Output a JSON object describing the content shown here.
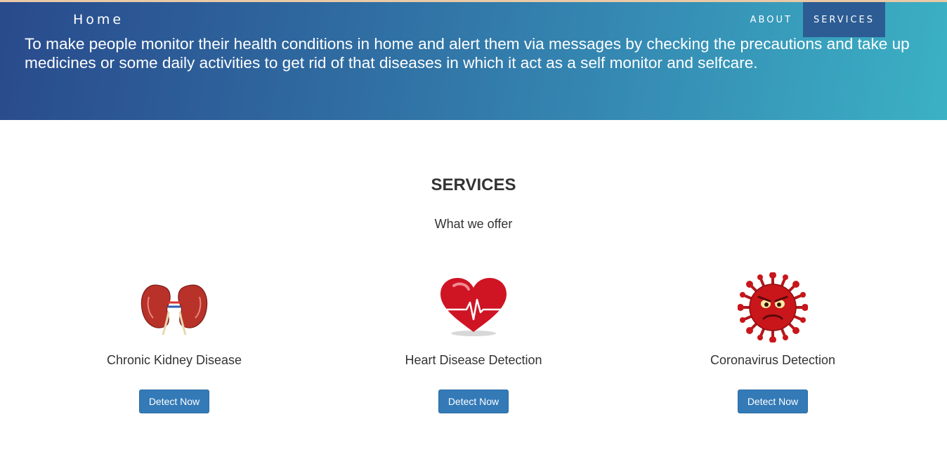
{
  "nav": {
    "brand": "Home",
    "items": [
      {
        "label": "ABOUT",
        "active": false
      },
      {
        "label": "SERVICES",
        "active": true
      }
    ]
  },
  "hero": {
    "mission": "To make people monitor their health conditions in home and alert them via messages by checking the precautions and take up medicines or some daily activities to get rid of that diseases in which it act as a self monitor and selfcare."
  },
  "services": {
    "title": "SERVICES",
    "subtitle": "What we offer",
    "cards": [
      {
        "label": "Chronic Kidney Disease",
        "icon": "kidney-icon",
        "button": "Detect Now"
      },
      {
        "label": "Heart Disease Detection",
        "icon": "heart-icon",
        "button": "Detect Now"
      },
      {
        "label": "Coronavirus Detection",
        "icon": "coronavirus-icon",
        "button": "Detect Now"
      }
    ]
  },
  "colors": {
    "hero_start": "#294a8c",
    "hero_end": "#3bb1c4",
    "button": "#337ab7",
    "nav_active": "#2c5c93"
  }
}
